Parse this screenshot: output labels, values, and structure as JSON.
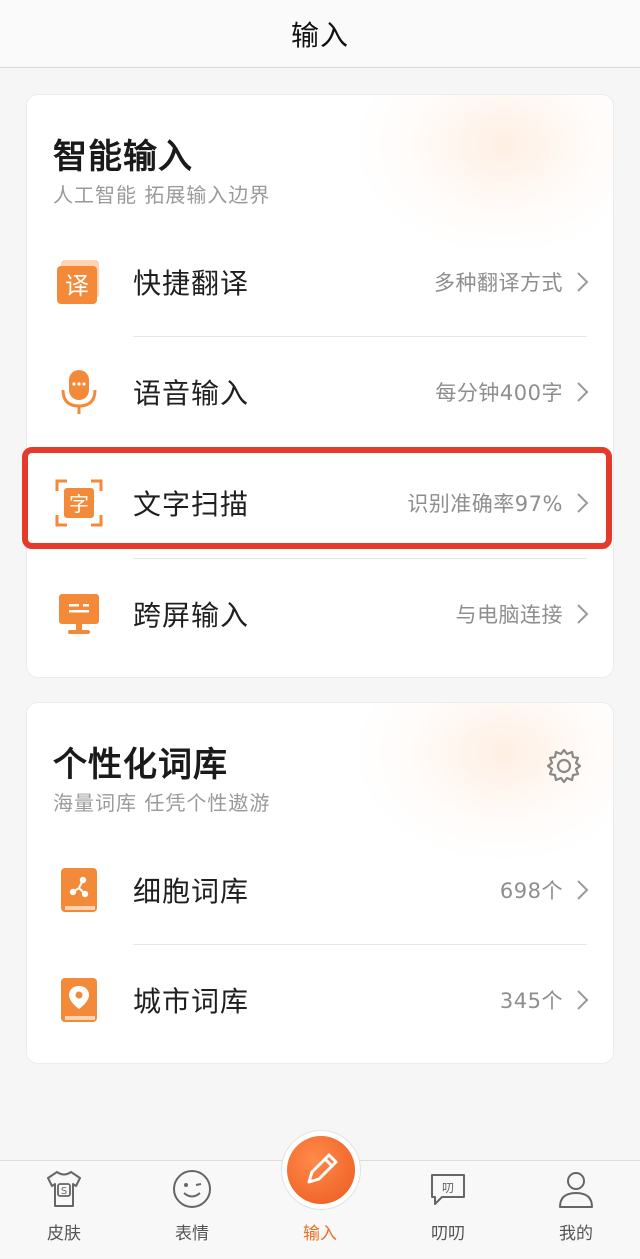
{
  "navbar": {
    "title": "输入"
  },
  "smart_input": {
    "title": "智能输入",
    "subtitle": "人工智能 拓展输入边界",
    "items": [
      {
        "label": "快捷翻译",
        "meta": "多种翻译方式",
        "icon": "translate-icon"
      },
      {
        "label": "语音输入",
        "meta": "每分钟400字",
        "icon": "microphone-icon"
      },
      {
        "label": "文字扫描",
        "meta": "识别准确率97%",
        "icon": "text-scan-icon"
      },
      {
        "label": "跨屏输入",
        "meta": "与电脑连接",
        "icon": "monitor-icon"
      }
    ]
  },
  "dictionary": {
    "title": "个性化词库",
    "subtitle": "海量词库 任凭个性遨游",
    "items": [
      {
        "label": "细胞词库",
        "meta": "698个",
        "icon": "cell-dictionary-icon"
      },
      {
        "label": "城市词库",
        "meta": "345个",
        "icon": "city-dictionary-icon"
      }
    ]
  },
  "tabbar": {
    "items": [
      {
        "label": "皮肤",
        "icon": "tshirt-icon"
      },
      {
        "label": "表情",
        "icon": "smiley-icon"
      },
      {
        "label": "输入",
        "icon": "pencil-icon",
        "active": true
      },
      {
        "label": "叨叨",
        "icon": "chat-bubble-icon"
      },
      {
        "label": "我的",
        "icon": "user-icon"
      }
    ]
  },
  "colors": {
    "accent": "#ef6f24",
    "highlight_border": "#e53a2a"
  }
}
